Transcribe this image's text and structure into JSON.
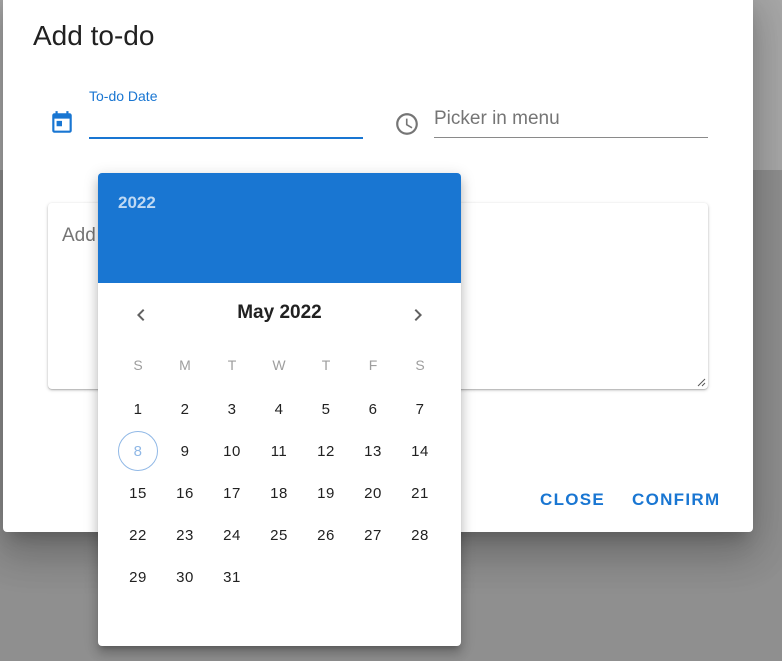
{
  "dialog": {
    "title": "Add to-do",
    "date_field": {
      "label": "To-do Date",
      "value": "",
      "icon": "calendar-icon"
    },
    "time_field": {
      "placeholder": "Picker in menu",
      "value": "",
      "icon": "clock-icon"
    },
    "textarea": {
      "placeholder": "Add"
    },
    "actions": {
      "close_label": "CLOSE",
      "confirm_label": "CONFIRM"
    }
  },
  "date_picker": {
    "year": "2022",
    "month_title": "May 2022",
    "prev_icon": "chevron-left-icon",
    "next_icon": "chevron-right-icon",
    "weekdays": [
      "S",
      "M",
      "T",
      "W",
      "T",
      "F",
      "S"
    ],
    "weeks": [
      [
        "1",
        "2",
        "3",
        "4",
        "5",
        "6",
        "7"
      ],
      [
        "8",
        "9",
        "10",
        "11",
        "12",
        "13",
        "14"
      ],
      [
        "15",
        "16",
        "17",
        "18",
        "19",
        "20",
        "21"
      ],
      [
        "22",
        "23",
        "24",
        "25",
        "26",
        "27",
        "28"
      ],
      [
        "29",
        "30",
        "31"
      ]
    ],
    "today": "8"
  },
  "colors": {
    "primary": "#1976d2",
    "today_ring": "#90b8e6"
  }
}
